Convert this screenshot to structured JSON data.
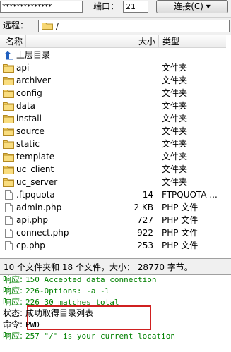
{
  "connection": {
    "password_mask": "**************",
    "port_label": "端口：",
    "port_value": "21",
    "connect_label": "连接(C)  ▾"
  },
  "remote": {
    "label": "远程：",
    "path": "/"
  },
  "columns": {
    "name": "名称",
    "size": "大小",
    "type": "类型"
  },
  "rows": [
    {
      "name": "上层目录",
      "size": "",
      "type": "",
      "icon": "up-arrow-icon"
    },
    {
      "name": "api",
      "size": "",
      "type": "文件夹",
      "icon": "folder-icon"
    },
    {
      "name": "archiver",
      "size": "",
      "type": "文件夹",
      "icon": "folder-icon"
    },
    {
      "name": "config",
      "size": "",
      "type": "文件夹",
      "icon": "folder-icon"
    },
    {
      "name": "data",
      "size": "",
      "type": "文件夹",
      "icon": "folder-icon"
    },
    {
      "name": "install",
      "size": "",
      "type": "文件夹",
      "icon": "folder-icon"
    },
    {
      "name": "source",
      "size": "",
      "type": "文件夹",
      "icon": "folder-icon"
    },
    {
      "name": "static",
      "size": "",
      "type": "文件夹",
      "icon": "folder-icon"
    },
    {
      "name": "template",
      "size": "",
      "type": "文件夹",
      "icon": "folder-icon"
    },
    {
      "name": "uc_client",
      "size": "",
      "type": "文件夹",
      "icon": "folder-icon"
    },
    {
      "name": "uc_server",
      "size": "",
      "type": "文件夹",
      "icon": "folder-icon"
    },
    {
      "name": ".ftpquota",
      "size": "14",
      "type": "FTPQUOTA ...",
      "icon": "file-icon"
    },
    {
      "name": "admin.php",
      "size": "2 KB",
      "type": "PHP 文件",
      "icon": "file-icon"
    },
    {
      "name": "api.php",
      "size": "727",
      "type": "PHP 文件",
      "icon": "file-icon"
    },
    {
      "name": "connect.php",
      "size": "922",
      "type": "PHP 文件",
      "icon": "file-icon"
    },
    {
      "name": "cp.php",
      "size": "253",
      "type": "PHP 文件",
      "icon": "file-icon"
    }
  ],
  "status_bar": "10 个文件夹和 18 个文件，大小：  28770 字节。",
  "log": [
    {
      "label": "响应:",
      "msg": "150 Accepted data connection",
      "color": "green"
    },
    {
      "label": "响应:",
      "msg": "226-Options: -a -l",
      "color": "green"
    },
    {
      "label": "响应:",
      "msg": "226 30 matches total",
      "color": "green"
    },
    {
      "label": "状态:",
      "msg": "成功取得目录列表",
      "color": "black"
    },
    {
      "label": "命令:",
      "msg": "PWD",
      "color": "black"
    },
    {
      "label": "响应:",
      "msg": "257 \"/\" is your current location",
      "color": "green"
    }
  ]
}
